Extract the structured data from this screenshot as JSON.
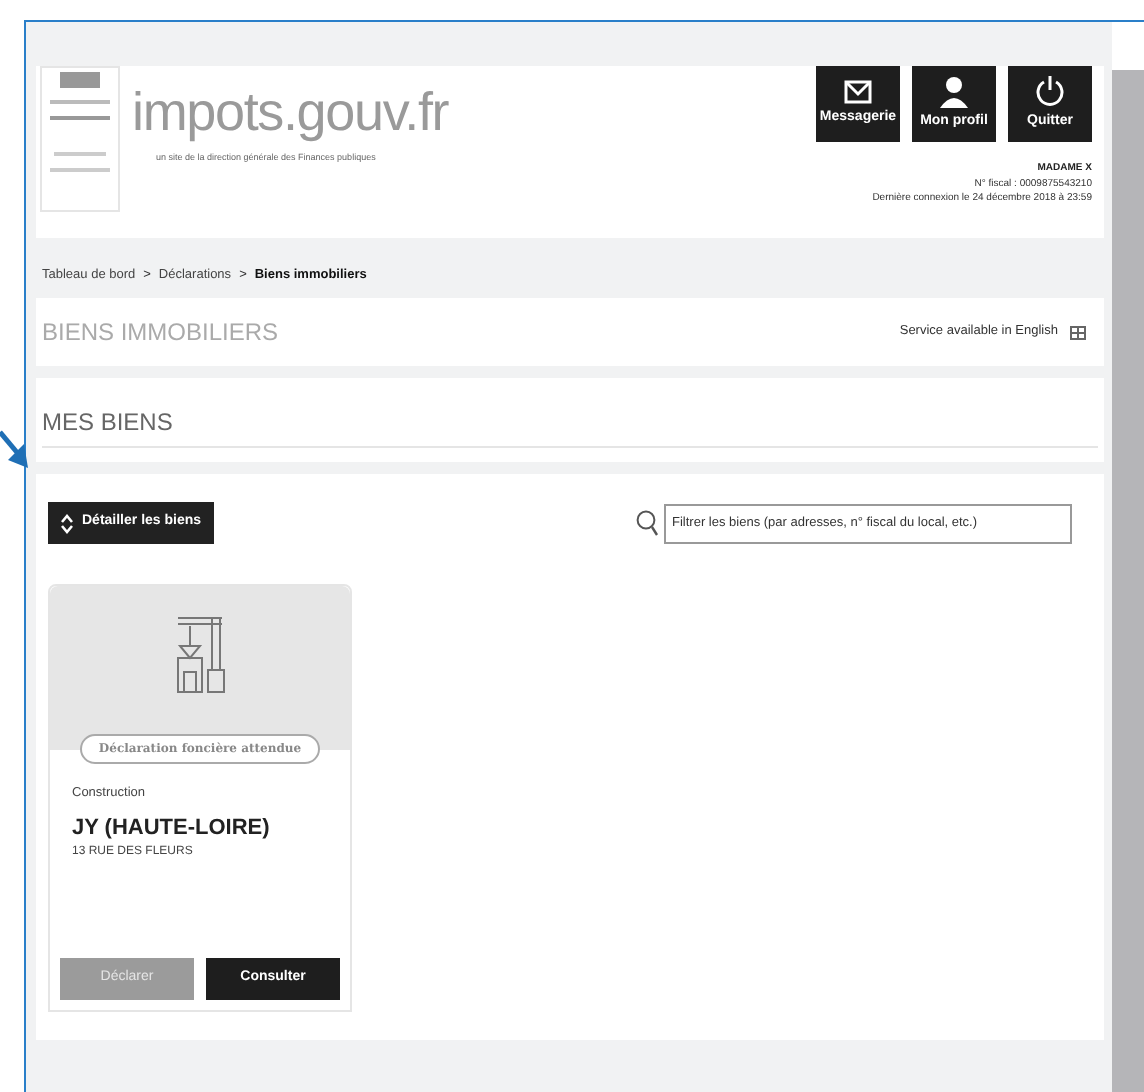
{
  "header": {
    "logo_text": "impots.gouv.fr",
    "tagline": "un site de la direction générale des Finances publiques",
    "buttons": [
      {
        "label": "Messagerie",
        "kind": "mail"
      },
      {
        "label": "Mon profil",
        "kind": "profile"
      },
      {
        "label": "Quitter",
        "kind": "logout"
      }
    ],
    "user": {
      "name": "MADAME X",
      "fiscal_number": "N° fiscal : 0009875543210",
      "last_login": "Dernière connexion le 24 décembre 2018 à 23:59"
    }
  },
  "breadcrumb": [
    {
      "label": "Tableau de bord",
      "selected": false
    },
    {
      "label": "Déclarations",
      "selected": false
    },
    {
      "label": "Biens immobiliers",
      "selected": true
    }
  ],
  "breadcrumb_separator": ">",
  "page_title": "BIENS IMMOBILIERS",
  "english_link": "Service available in English",
  "section_title": "MES BIENS",
  "detail_button": "Détailler les biens",
  "filter": {
    "placeholder": "Filtrer les biens (par adresses, n° fiscal du local, etc.)"
  },
  "properties": [
    {
      "status": "Déclaration foncière attendue",
      "type": "Construction",
      "city": "JY (HAUTE-LOIRE)",
      "address": "13 RUE DES FLEURS",
      "actions": [
        {
          "label": "Déclarer",
          "disabled": true
        },
        {
          "label": "Consulter",
          "disabled": false
        }
      ]
    }
  ]
}
